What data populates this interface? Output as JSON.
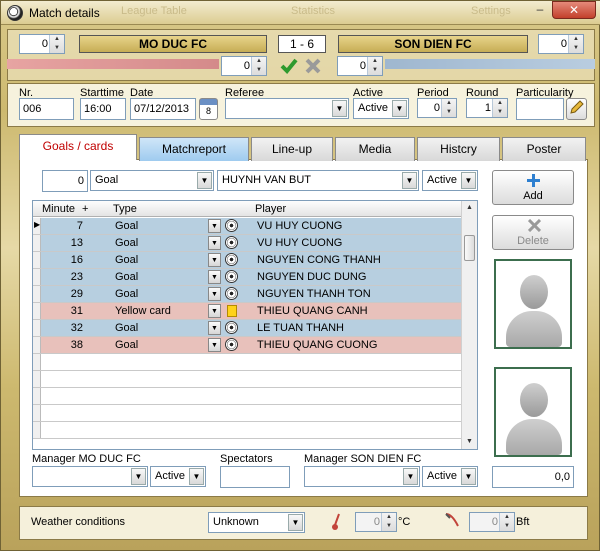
{
  "window": {
    "title": "Match details",
    "ghost_tabs": [
      "League Table",
      "Statistics",
      "Settings"
    ],
    "minimize": "–",
    "close": "✕"
  },
  "score": {
    "home_spin": "0",
    "away_spin": "0",
    "home_team": "MO DUC FC",
    "away_team": "SON DIEN FC",
    "result": "1  - 6",
    "home_sub_spin": "0",
    "away_sub_spin": "0"
  },
  "match": {
    "nr_label": "Nr.",
    "nr_value": "006",
    "starttime_label": "Starttime",
    "starttime_value": "16:00",
    "date_label": "Date",
    "date_value": "07/12/2013",
    "calendar_icon_text": "8",
    "referee_label": "Referee",
    "referee_value": "",
    "active_label": "Active",
    "active_value": "Active",
    "period_label": "Period",
    "period_value": "0",
    "round_label": "Round",
    "round_value": "1",
    "particularity_label": "Particularity",
    "particularity_value": ""
  },
  "tabs": [
    {
      "label": "Goals / cards",
      "state": "active"
    },
    {
      "label": "Matchreport",
      "state": "selected"
    },
    {
      "label": "Line-up",
      "state": "normal"
    },
    {
      "label": "Media",
      "state": "normal"
    },
    {
      "label": "Histcry",
      "state": "normal"
    },
    {
      "label": "Poster",
      "state": "normal"
    }
  ],
  "entry": {
    "minute": "0",
    "type": "Goal",
    "player": "HUYNH VAN BUT",
    "status": "Active"
  },
  "buttons": {
    "add": "Add",
    "delete": "Delete"
  },
  "grid": {
    "headers": {
      "minute": "Minute",
      "plus": "+",
      "type": "Type",
      "player": "Player"
    },
    "rows": [
      {
        "minute": "7",
        "type": "Goal",
        "icon": "ball",
        "player": "VU HUY CUONG",
        "color": "#b7cfe0",
        "current": true
      },
      {
        "minute": "13",
        "type": "Goal",
        "icon": "ball",
        "player": "VU HUY CUONG",
        "color": "#b7cfe0"
      },
      {
        "minute": "16",
        "type": "Goal",
        "icon": "ball",
        "player": "NGUYEN CONG THANH",
        "color": "#b7cfe0"
      },
      {
        "minute": "23",
        "type": "Goal",
        "icon": "ball",
        "player": "NGUYEN DUC DUNG",
        "color": "#b7cfe0"
      },
      {
        "minute": "29",
        "type": "Goal",
        "icon": "ball",
        "player": "NGUYEN THANH TON",
        "color": "#b7cfe0"
      },
      {
        "minute": "31",
        "type": "Yellow card",
        "icon": "yellow-card",
        "player": "THIEU QUANG CANH",
        "color": "#e8c1bb"
      },
      {
        "minute": "32",
        "type": "Goal",
        "icon": "ball",
        "player": "LE TUAN THANH",
        "color": "#b7cfe0"
      },
      {
        "minute": "38",
        "type": "Goal",
        "icon": "ball",
        "player": "THIEU QUANG CUONG",
        "color": "#e8c1bb"
      }
    ],
    "empty_rows": 5
  },
  "bottom": {
    "manager_home_label": "Manager MO DUC FC",
    "manager_home_value": "",
    "manager_home_status": "Active",
    "spectators_label": "Spectators",
    "spectators_value": "",
    "manager_away_label": "Manager SON DIEN FC",
    "manager_away_value": "",
    "manager_away_status": "Active",
    "rating_value": "0,0"
  },
  "weather": {
    "label": "Weather conditions",
    "condition": "Unknown",
    "temperature": "0",
    "temperature_unit": "°C",
    "wind": "0",
    "wind_unit": "Bft"
  },
  "colors": {
    "goal_row": "#b7cfe0",
    "away_row": "#e8c1bb",
    "accent_tab_text": "#c00000",
    "window_gold": "#cdb96f"
  }
}
